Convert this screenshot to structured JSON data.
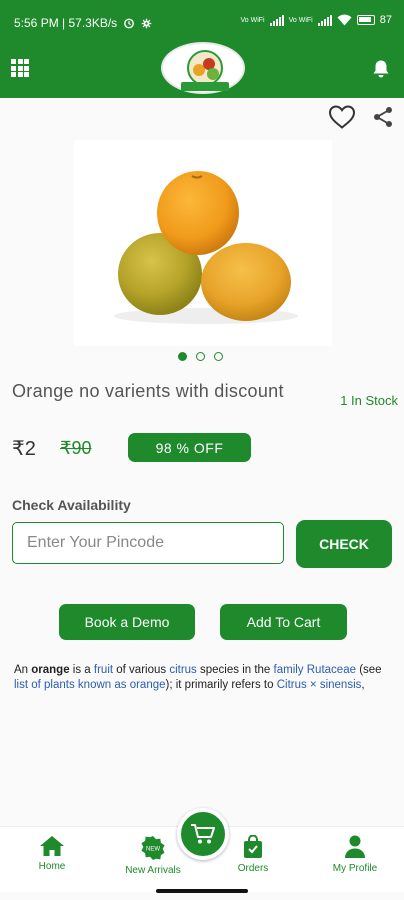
{
  "status_bar": {
    "time_speed": "5:56 PM | 57.3KB/s",
    "battery": "87",
    "network_label": "Vo WiFi"
  },
  "colors": {
    "primary": "#1e8a2b",
    "link": "#2a5db0"
  },
  "app_bar": {
    "menu_icon": "grid-icon",
    "logo": "store-logo",
    "notification_icon": "bell-icon"
  },
  "product": {
    "title": "Orange no varients with discount",
    "stock": "1 In Stock",
    "price": "₹2",
    "mrp": "₹90",
    "discount": "98 % OFF",
    "image_dots": 3,
    "active_dot": 0
  },
  "availability": {
    "label": "Check Availability",
    "pincode_placeholder": "Enter Your Pincode",
    "pincode_value": "",
    "check_label": "CHECK"
  },
  "actions": {
    "demo_label": "Book a Demo",
    "cart_label": "Add To Cart"
  },
  "description": {
    "p1": "An ",
    "orange": "orange",
    "p2": " is a ",
    "fruit": "fruit",
    "p3": " of various ",
    "citrus": "citrus",
    "p4": " species in the ",
    "family": "family Rutaceae",
    "p5": " (see ",
    "list": "list of plants known as orange",
    "p6": "); it primarily refers to ",
    "sinensis": "Citrus × sinensis",
    "p7": ","
  },
  "bottom_nav": {
    "home": "Home",
    "new_arrivals": "New Arrivals",
    "new_badge": "NEW",
    "orders": "Orders",
    "profile": "My Profile"
  }
}
